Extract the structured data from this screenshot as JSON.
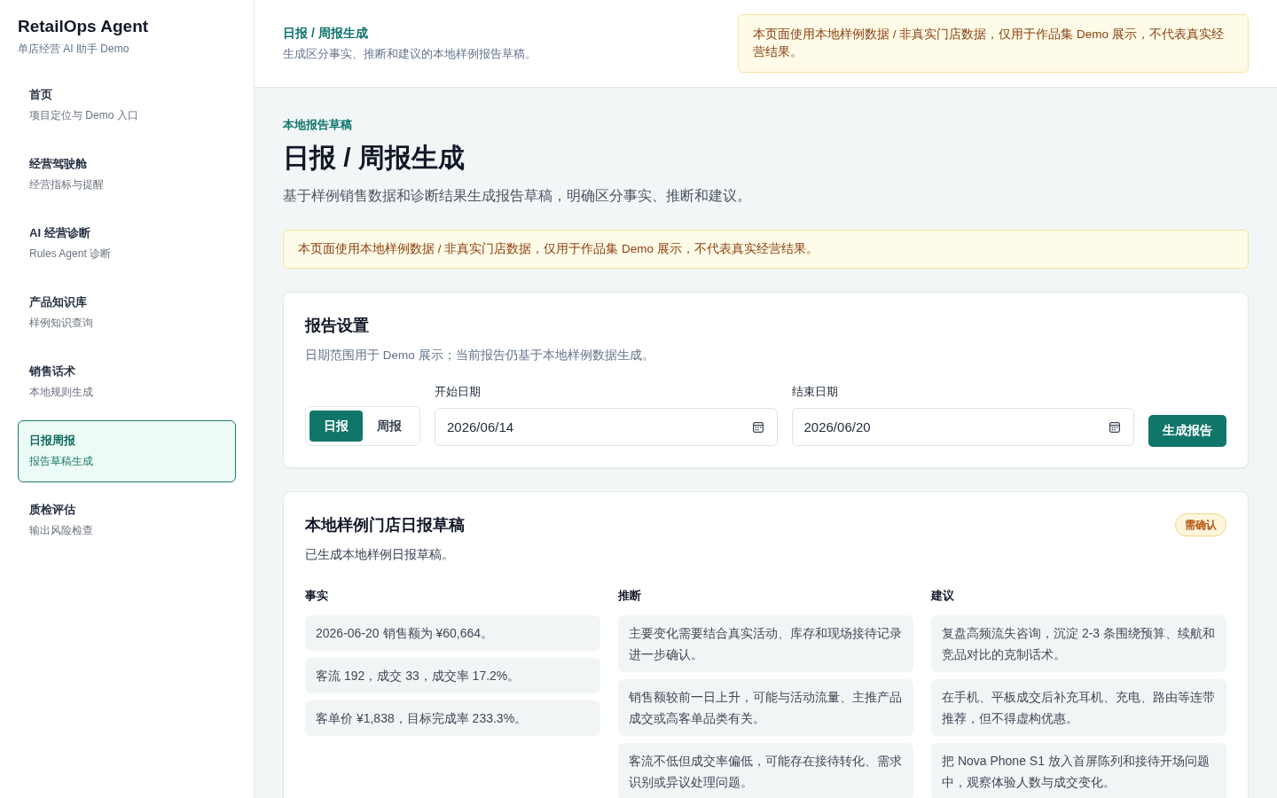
{
  "sidebar": {
    "brand": {
      "title": "RetailOps Agent",
      "subtitle": "单店经营 AI 助手 Demo"
    },
    "items": [
      {
        "title": "首页",
        "subtitle": "项目定位与 Demo 入口",
        "selected": false
      },
      {
        "title": "经营驾驶舱",
        "subtitle": "经营指标与提醒",
        "selected": false
      },
      {
        "title": "AI 经营诊断",
        "subtitle": "Rules Agent 诊断",
        "selected": false
      },
      {
        "title": "产品知识库",
        "subtitle": "样例知识查询",
        "selected": false
      },
      {
        "title": "销售话术",
        "subtitle": "本地规则生成",
        "selected": false
      },
      {
        "title": "日报周报",
        "subtitle": "报告草稿生成",
        "selected": true
      },
      {
        "title": "质检评估",
        "subtitle": "输出风险检查",
        "selected": false
      }
    ]
  },
  "header": {
    "breadcrumb": "日报 / 周报生成",
    "subtitle": "生成区分事实、推断和建议的本地样例报告草稿。",
    "notice": "本页面使用本地样例数据 / 非真实门店数据，仅用于作品集 Demo 展示，不代表真实经营结果。"
  },
  "page": {
    "eyebrow": "本地报告草稿",
    "title": "日报 / 周报生成",
    "description": "基于样例销售数据和诊断结果生成报告草稿，明确区分事实、推断和建议。",
    "notice": "本页面使用本地样例数据 / 非真实门店数据，仅用于作品集 Demo 展示，不代表真实经营结果。"
  },
  "settings": {
    "title": "报告设置",
    "hint": "日期范围用于 Demo 展示；当前报告仍基于本地样例数据生成。",
    "period_tabs": [
      {
        "label": "日报",
        "selected": true
      },
      {
        "label": "周报",
        "selected": false
      }
    ],
    "start_date": {
      "label": "开始日期",
      "value": "2026/06/14"
    },
    "end_date": {
      "label": "结束日期",
      "value": "2026/06/20"
    },
    "generate_button": "生成报告"
  },
  "report": {
    "title": "本地样例门店日报草稿",
    "badge": "需确认",
    "status": "已生成本地样例日报草稿。",
    "columns": [
      {
        "heading": "事实",
        "items": [
          "2026-06-20 销售额为 ¥60,664。",
          "客流 192，成交 33，成交率 17.2%。",
          "客单价 ¥1,838，目标完成率 233.3%。"
        ]
      },
      {
        "heading": "推断",
        "items": [
          "主要变化需要结合真实活动、库存和现场接待记录进一步确认。",
          "销售额较前一日上升，可能与活动流量、主推产品成交或高客单品类有关。",
          "客流不低但成交率偏低，可能存在接待转化、需求识别或异议处理问题。"
        ]
      },
      {
        "heading": "建议",
        "items": [
          "复盘高频流失咨询，沉淀 2-3 条围绕预算、续航和竞品对比的克制话术。",
          "在手机、平板成交后补充耳机、充电、路由等连带推荐，但不得虚构优惠。",
          "把 Nova Phone S1 放入首屏陈列和接待开场问题中，观察体验人数与成交变化。"
        ]
      }
    ]
  }
}
